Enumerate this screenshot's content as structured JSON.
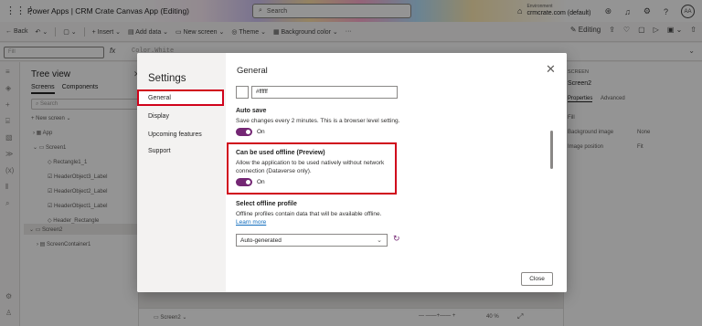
{
  "titlebar": {
    "app_title": "Power Apps  |  CRM Crate Canvas App (Editing)",
    "search_placeholder": "Search",
    "env_label": "Environment",
    "env_value": "crmcrate.com (default)",
    "avatar": "AA"
  },
  "cmdbar": {
    "back": "Back",
    "insert": "Insert",
    "add_data": "Add data",
    "new_screen": "New screen",
    "theme": "Theme",
    "background_color": "Background color",
    "more": "···",
    "editing": "Editing"
  },
  "formula": {
    "property": "Fill",
    "fx": "fx",
    "value": "Color.White"
  },
  "tree": {
    "title": "Tree view",
    "tabs": [
      "Screens",
      "Components"
    ],
    "search_placeholder": "Search",
    "new_screen": "New screen",
    "items": [
      "App",
      "Screen1",
      "Rectangle1_1",
      "HeaderObject3_Label",
      "HeaderObject2_Label",
      "HeaderObject1_Label",
      "Header_Rectangle",
      "Screen2",
      "ScreenContainer1"
    ]
  },
  "right_panel": {
    "label": "SCREEN",
    "name": "Screen2",
    "tabs": [
      "Properties",
      "Advanced"
    ],
    "fill": "Fill",
    "bg_image": "Background image",
    "bg_image_value": "None",
    "image_position": "Image position",
    "image_position_value": "Fit"
  },
  "canvas_bottom": {
    "screen": "Screen2",
    "zoom": "40 %"
  },
  "dialog": {
    "title": "Settings",
    "nav": [
      "General",
      "Display",
      "Upcoming features",
      "Support"
    ],
    "selected_nav": "General",
    "content_title": "General",
    "color_value": "#ffffff",
    "autosave": {
      "heading": "Auto save",
      "desc": "Save changes every 2 minutes. This is a browser level setting.",
      "toggle": "On"
    },
    "offline": {
      "heading": "Can be used offline (Preview)",
      "desc": "Allow the application to be used natively without network connection (Dataverse only).",
      "toggle": "On"
    },
    "offline_profile": {
      "heading": "Select offline profile",
      "desc": "Offline profiles contain data that will be available offline.",
      "link": "Learn more",
      "dropdown": "Auto-generated"
    },
    "close": "Close"
  },
  "colors": {
    "accent": "#742774",
    "highlight": "#d0021b"
  }
}
